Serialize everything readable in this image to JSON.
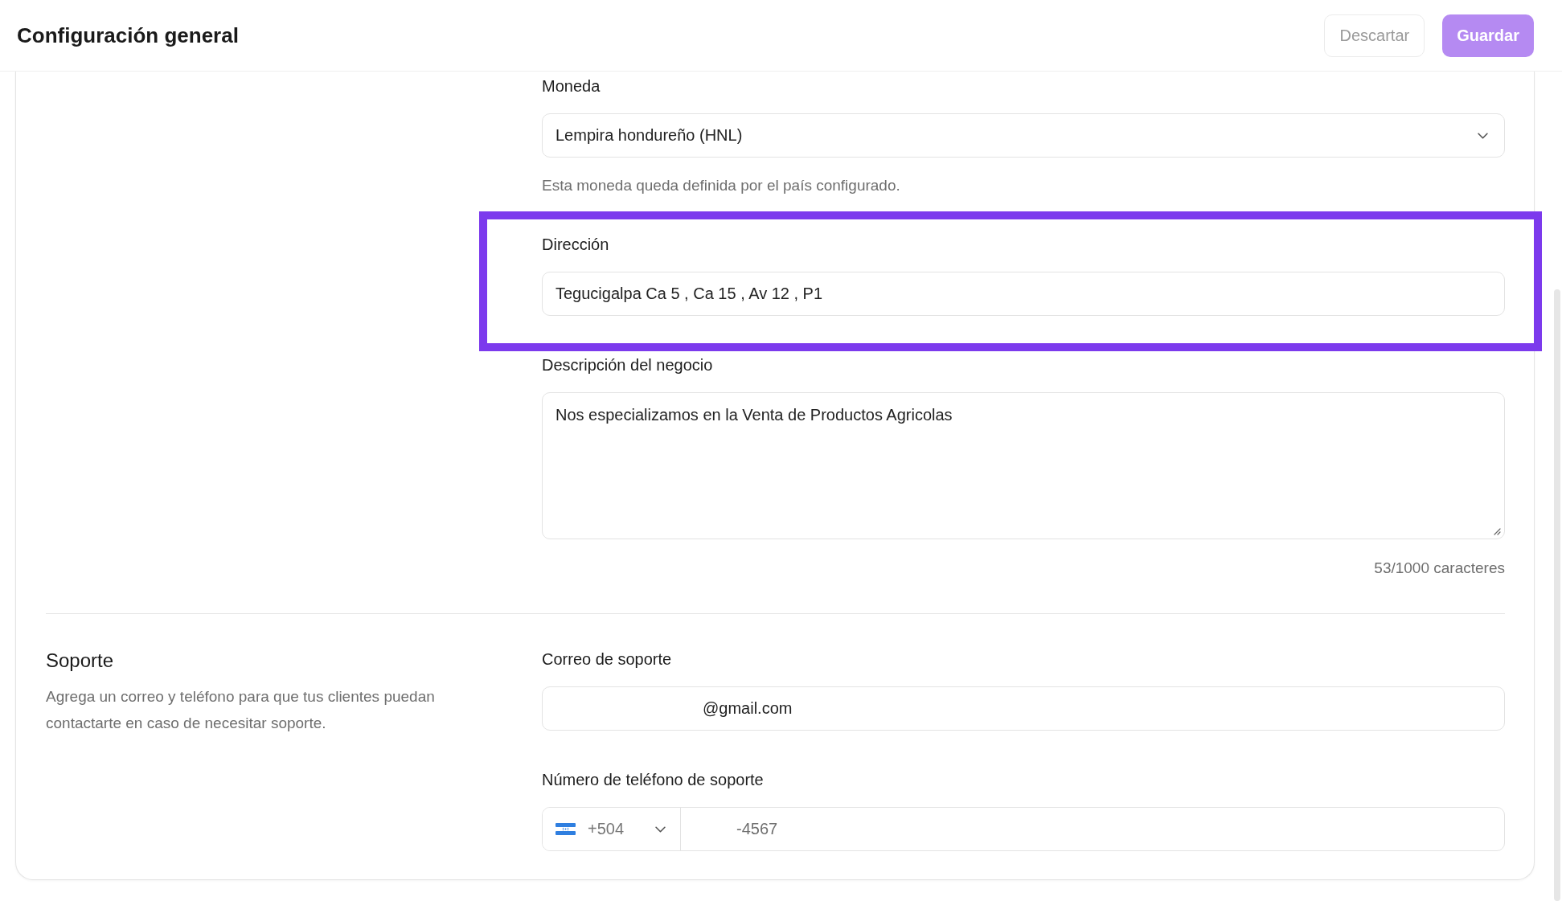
{
  "header": {
    "title": "Configuración general",
    "buttons": [
      {
        "label": "Descartar",
        "kind": "secondary",
        "disabled": true
      },
      {
        "label": "Guardar",
        "kind": "primary",
        "disabled": true
      }
    ]
  },
  "sections": [
    {
      "fields": [
        {
          "kind": "select",
          "label": "Moneda",
          "value": "Lempira hondureño (HNL)",
          "help": "Esta moneda queda definida por el país configurado.",
          "highlighted": false
        },
        {
          "kind": "text",
          "label": "Dirección",
          "value": "Tegucigalpa Ca 5 , Ca 15 , Av 12 , P1",
          "highlighted": true
        },
        {
          "kind": "textarea",
          "label": "Descripción del negocio",
          "value": "Nos especializamos en la Venta de Productos Agricolas",
          "counter": "53/1000 caracteres",
          "highlighted": false
        }
      ]
    },
    {
      "title": "Soporte",
      "description": "Agrega un correo y teléfono para que tus clientes puedan contactarte en caso de necesitar soporte.",
      "fields": [
        {
          "kind": "text",
          "label": "Correo de soporte",
          "value": "@gmail.com",
          "redacted": true,
          "highlighted": false
        },
        {
          "kind": "phone",
          "label": "Número de teléfono de soporte",
          "country_code": "+504",
          "value": "-4567",
          "redacted": true,
          "highlighted": false
        }
      ]
    }
  ]
}
